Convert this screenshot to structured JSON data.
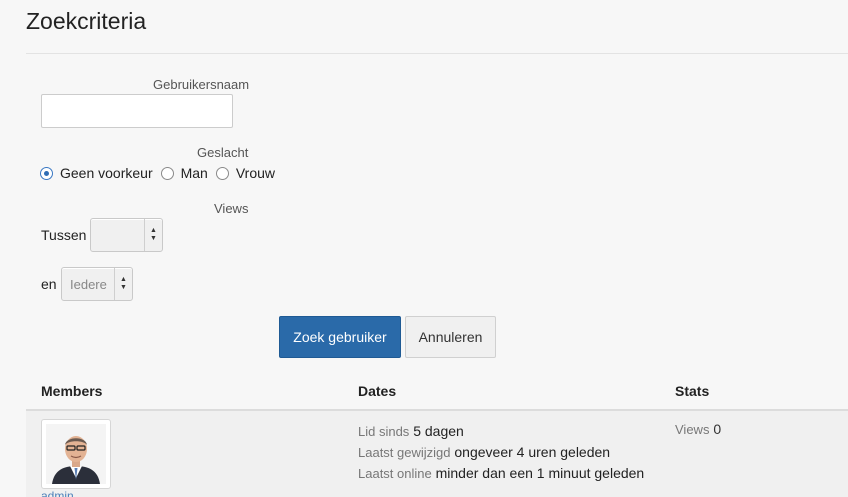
{
  "page_title": "Zoekcriteria",
  "form": {
    "username_label": "Gebruikersnaam",
    "username_value": "",
    "gender_label": "Geslacht",
    "gender_options": [
      "Geen voorkeur",
      "Man",
      "Vrouw"
    ],
    "gender_selected": "Geen voorkeur",
    "views_label": "Views",
    "between_label": "Tussen",
    "between_value": "",
    "and_label": "en",
    "and_value": "Iedere",
    "search_button": "Zoek gebruiker",
    "cancel_button": "Annuleren"
  },
  "table": {
    "headers": [
      "Members",
      "Dates",
      "Stats"
    ],
    "rows": [
      {
        "member_name": "admin",
        "dates": [
          {
            "key": "Lid sinds",
            "value": "5 dagen"
          },
          {
            "key": "Laatst gewijzigd",
            "value": "ongeveer 4 uren geleden"
          },
          {
            "key": "Laatst online",
            "value": "minder dan een 1 minuut geleden"
          }
        ],
        "stats": {
          "key": "Views",
          "value": "0"
        }
      }
    ]
  }
}
